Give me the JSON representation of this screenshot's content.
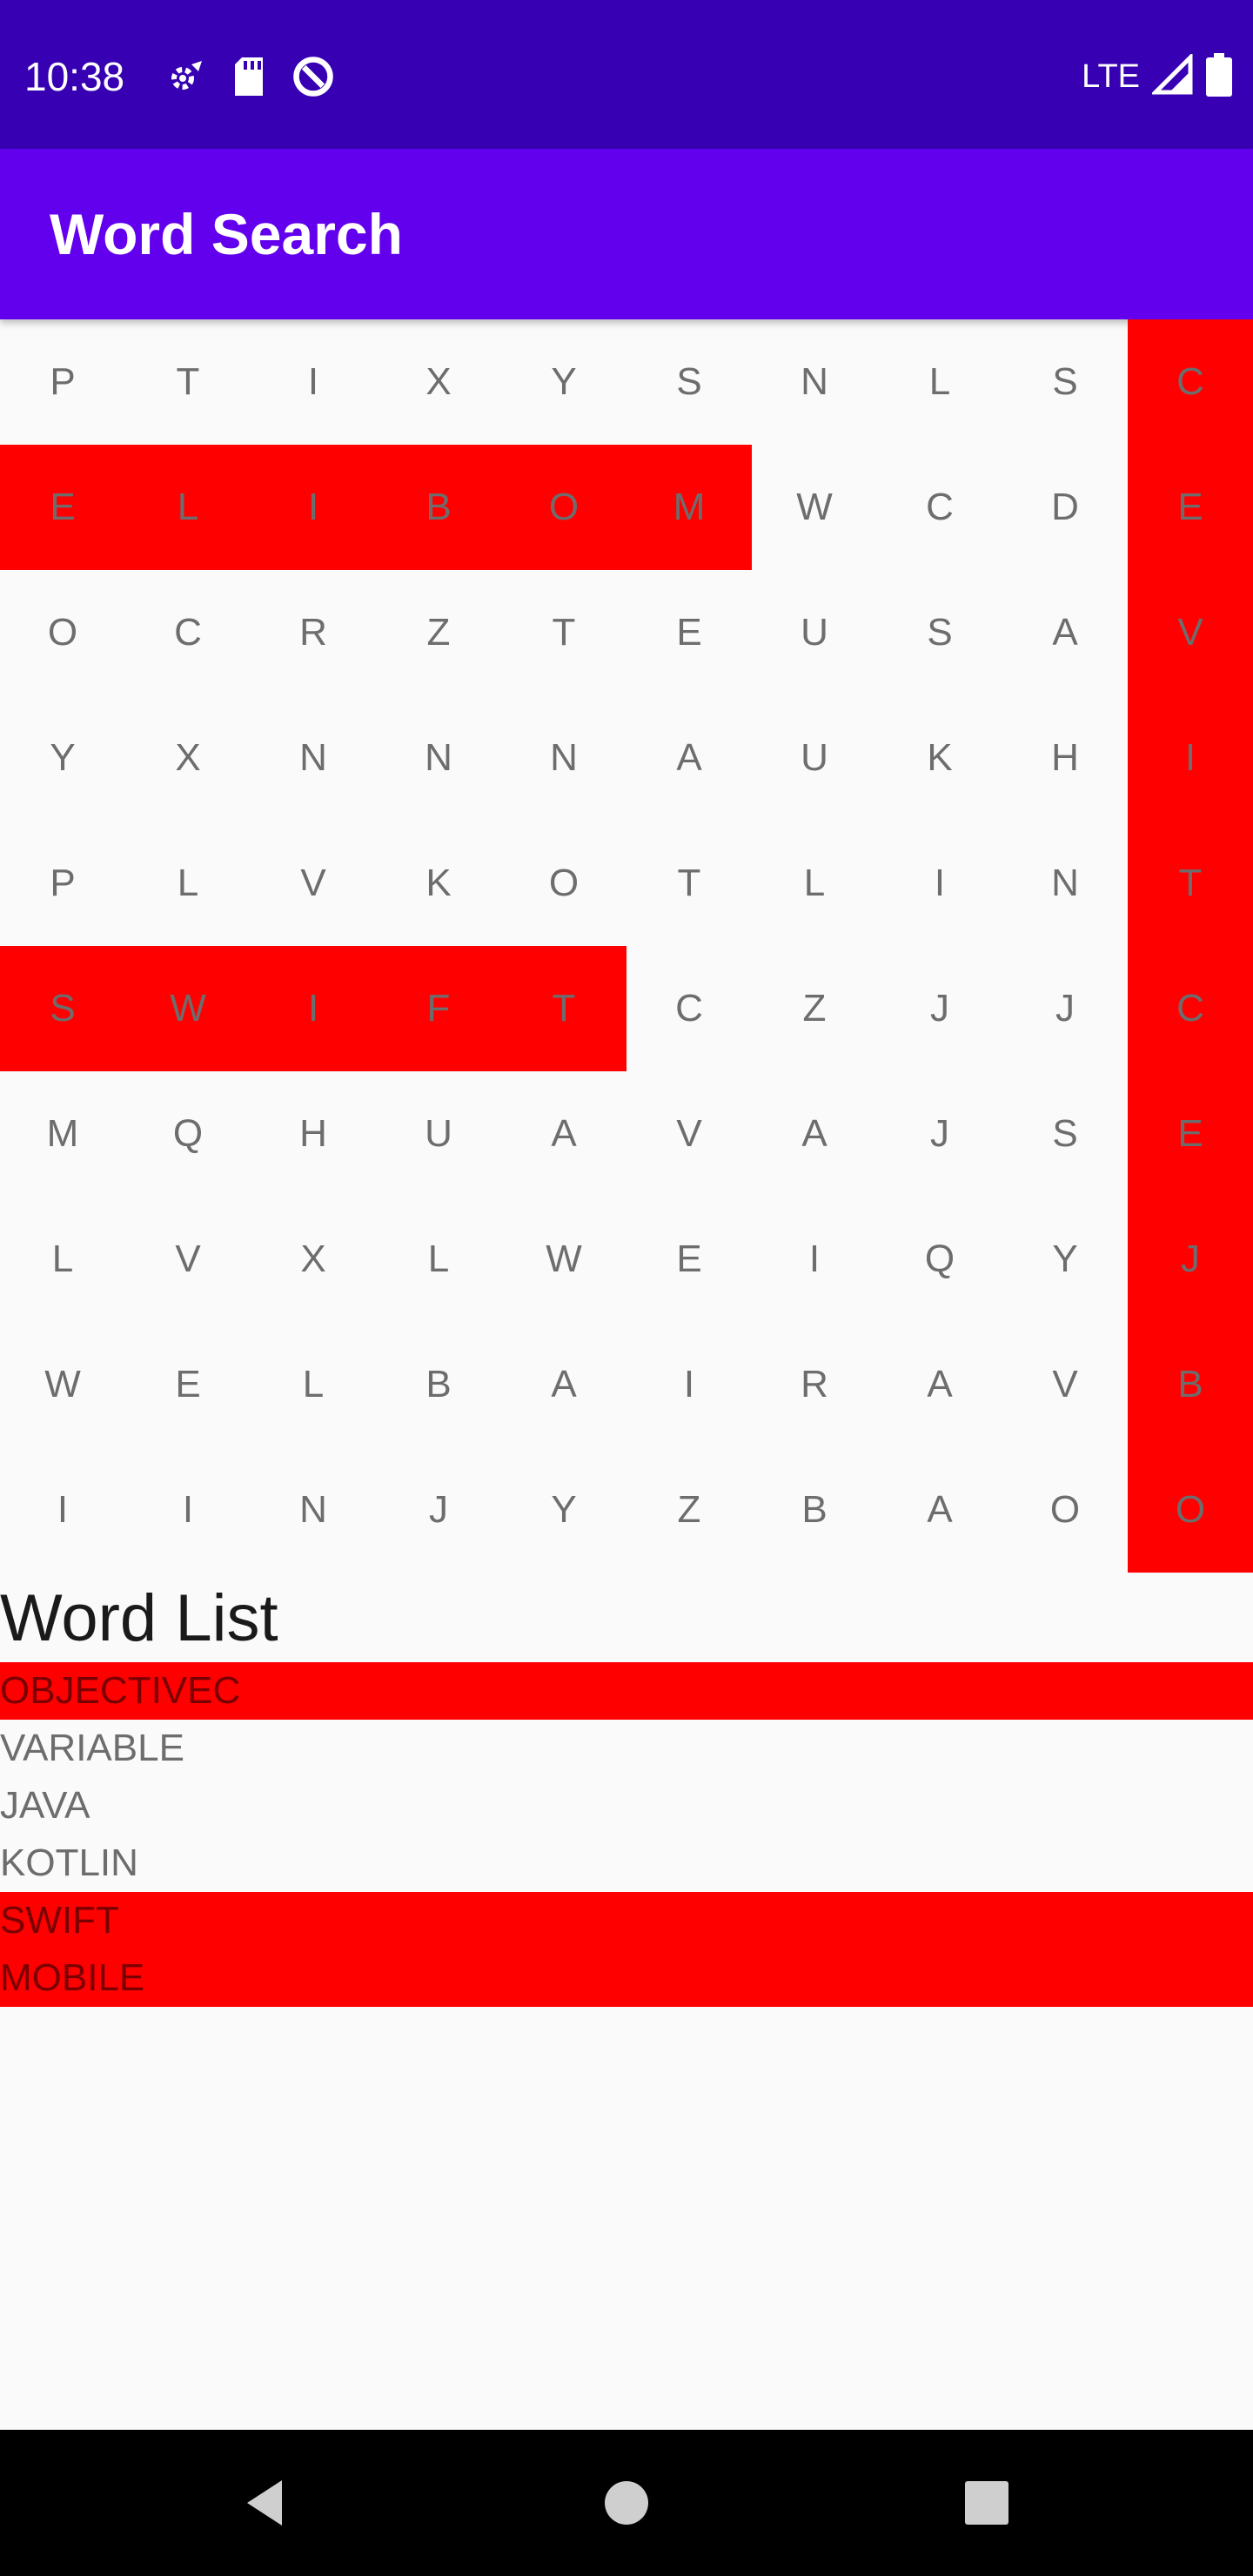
{
  "status_bar": {
    "time": "10:38",
    "network": "LTE",
    "left_icons": [
      "settings-icon",
      "sd-card-icon",
      "data-saver-icon"
    ],
    "right_icons": [
      "signal-icon",
      "battery-icon"
    ]
  },
  "app_bar": {
    "title": "Word Search"
  },
  "grid": {
    "rows": [
      [
        "P",
        "T",
        "I",
        "X",
        "Y",
        "S",
        "N",
        "L",
        "S",
        "C"
      ],
      [
        "E",
        "L",
        "I",
        "B",
        "O",
        "M",
        "W",
        "C",
        "D",
        "E"
      ],
      [
        "O",
        "C",
        "R",
        "Z",
        "T",
        "E",
        "U",
        "S",
        "A",
        "V"
      ],
      [
        "Y",
        "X",
        "N",
        "N",
        "N",
        "A",
        "U",
        "K",
        "H",
        "I"
      ],
      [
        "P",
        "L",
        "V",
        "K",
        "O",
        "T",
        "L",
        "I",
        "N",
        "T"
      ],
      [
        "S",
        "W",
        "I",
        "F",
        "T",
        "C",
        "Z",
        "J",
        "J",
        "C"
      ],
      [
        "M",
        "Q",
        "H",
        "U",
        "A",
        "V",
        "A",
        "J",
        "S",
        "E"
      ],
      [
        "L",
        "V",
        "X",
        "L",
        "W",
        "E",
        "I",
        "Q",
        "Y",
        "J"
      ],
      [
        "W",
        "E",
        "L",
        "B",
        "A",
        "I",
        "R",
        "A",
        "V",
        "B"
      ],
      [
        "I",
        "I",
        "N",
        "J",
        "Y",
        "Z",
        "B",
        "A",
        "O",
        "O"
      ]
    ],
    "highlight_color": "#ff0000"
  },
  "word_list": {
    "title": "Word List",
    "items": [
      {
        "word": "OBJECTIVEC",
        "found": true
      },
      {
        "word": "VARIABLE",
        "found": false
      },
      {
        "word": "JAVA",
        "found": false
      },
      {
        "word": "KOTLIN",
        "found": false
      },
      {
        "word": "SWIFT",
        "found": true
      },
      {
        "word": "MOBILE",
        "found": true
      }
    ]
  },
  "nav_bar": {
    "buttons": [
      "back-icon",
      "home-icon",
      "recents-icon"
    ]
  },
  "colors": {
    "status_bar": "#3700b3",
    "app_bar": "#6200ee",
    "highlight": "#ff0000"
  }
}
